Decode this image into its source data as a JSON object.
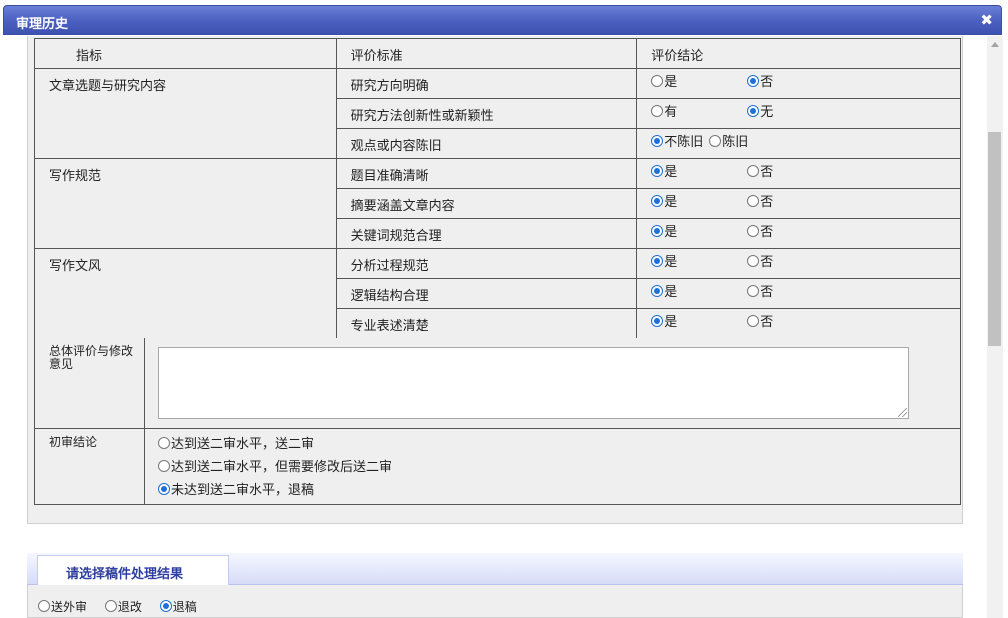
{
  "window": {
    "title": "审理历史"
  },
  "table": {
    "headers": [
      "指标",
      "评价标准",
      "评价结论"
    ],
    "groups": [
      {
        "category": "文章选题与研究内容",
        "rows": [
          {
            "criterion": "研究方向明确",
            "options": [
              "是",
              "否"
            ],
            "selected": 1
          },
          {
            "criterion": "研究方法创新性或新颖性",
            "options": [
              "有",
              "无"
            ],
            "selected": 1
          },
          {
            "criterion": "观点或内容陈旧",
            "options": [
              "不陈旧",
              "陈旧"
            ],
            "selected": 0
          }
        ]
      },
      {
        "category": "写作规范",
        "rows": [
          {
            "criterion": "题目准确清晰",
            "options": [
              "是",
              "否"
            ],
            "selected": 0
          },
          {
            "criterion": "摘要涵盖文章内容",
            "options": [
              "是",
              "否"
            ],
            "selected": 0
          },
          {
            "criterion": "关键词规范合理",
            "options": [
              "是",
              "否"
            ],
            "selected": 0
          }
        ]
      },
      {
        "category": "写作文风",
        "rows": [
          {
            "criterion": "分析过程规范",
            "options": [
              "是",
              "否"
            ],
            "selected": 0
          },
          {
            "criterion": "逻辑结构合理",
            "options": [
              "是",
              "否"
            ],
            "selected": 0
          },
          {
            "criterion": "专业表述清楚",
            "options": [
              "是",
              "否"
            ],
            "selected": 0
          }
        ]
      }
    ]
  },
  "comments": {
    "label": "总体评价与修改意见",
    "value": ""
  },
  "conclusion": {
    "label": "初审结论",
    "options": [
      "达到送二审水平，送二审",
      "达到送二审水平，但需要修改后送二审",
      "未达到送二审水平，退稿"
    ],
    "selected": 2
  },
  "result": {
    "tab_label": "请选择稿件处理结果",
    "options": [
      "送外审",
      "退改",
      "退稿"
    ],
    "selected": 2
  }
}
